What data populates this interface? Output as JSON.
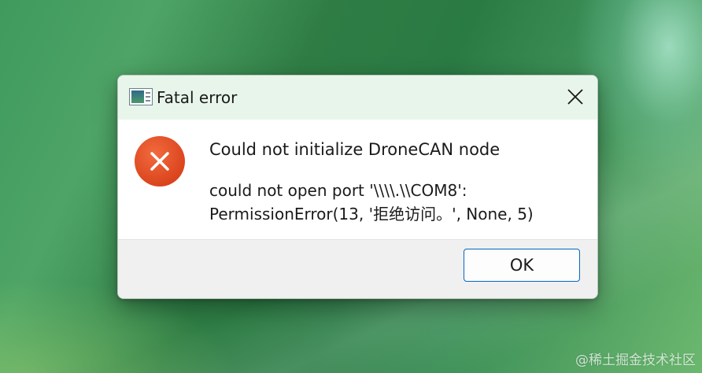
{
  "dialog": {
    "title": "Fatal error",
    "main_instruction": "Could not initialize DroneCAN node",
    "detail_lines": [
      "could not open port '\\\\\\\\.\\\\COM8':",
      "PermissionError(13, '拒绝访问。', None, 5)"
    ],
    "icons": {
      "app": "app-window-icon",
      "close": "close-icon",
      "status": "error-icon"
    },
    "buttons": {
      "ok_label": "OK"
    },
    "colors": {
      "error_icon": "#e4522a",
      "titlebar_bg": "#e8f5eb",
      "ok_border": "#0067c0"
    }
  },
  "watermark": "@稀土掘金技术社区"
}
